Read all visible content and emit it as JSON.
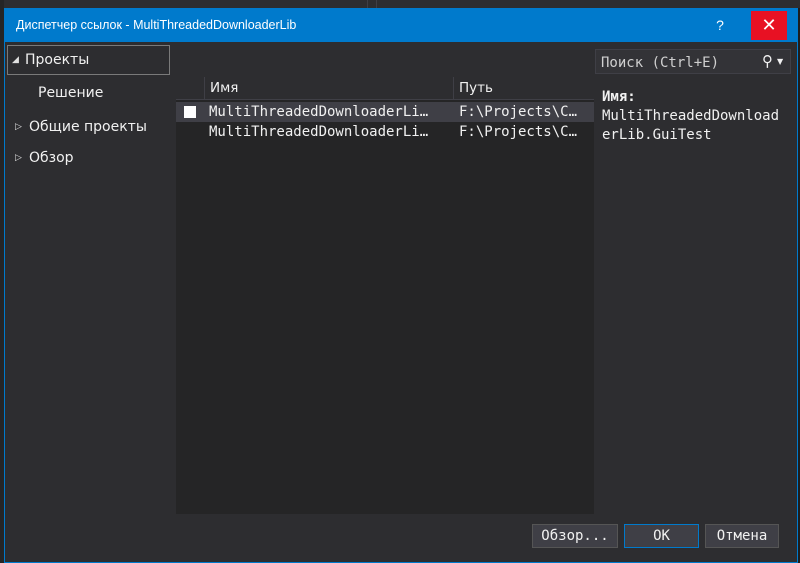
{
  "dialog": {
    "title": "Диспетчер ссылок - MultiThreadedDownloaderLib",
    "help": "?",
    "close": "✕"
  },
  "nav": {
    "items": [
      {
        "label": "Проекты",
        "expanded": true,
        "selected": true
      },
      {
        "label": "Решение",
        "expanded": null,
        "selected": false
      },
      {
        "label": "Общие проекты",
        "expanded": false,
        "selected": false
      },
      {
        "label": "Обзор",
        "expanded": false,
        "selected": false
      }
    ]
  },
  "search": {
    "placeholder": "Поиск (Ctrl+E)",
    "value": ""
  },
  "table": {
    "columns": [
      "Имя",
      "Путь"
    ],
    "rows": [
      {
        "name": "MultiThreadedDownloaderLi…",
        "path": "F:\\Projects\\C…",
        "checked": false,
        "selected": true
      },
      {
        "name": "MultiThreadedDownloaderLi…",
        "path": "F:\\Projects\\C…",
        "checked": null,
        "selected": false
      }
    ]
  },
  "details": {
    "label": "Имя:",
    "value": "MultiThreadedDownloaderLib.GuiTest"
  },
  "buttons": {
    "browse": "Обзор...",
    "ok": "ОК",
    "cancel": "Отмена"
  },
  "colors": {
    "accent": "#007acc",
    "close": "#e81123",
    "background": "#2d2d30"
  }
}
